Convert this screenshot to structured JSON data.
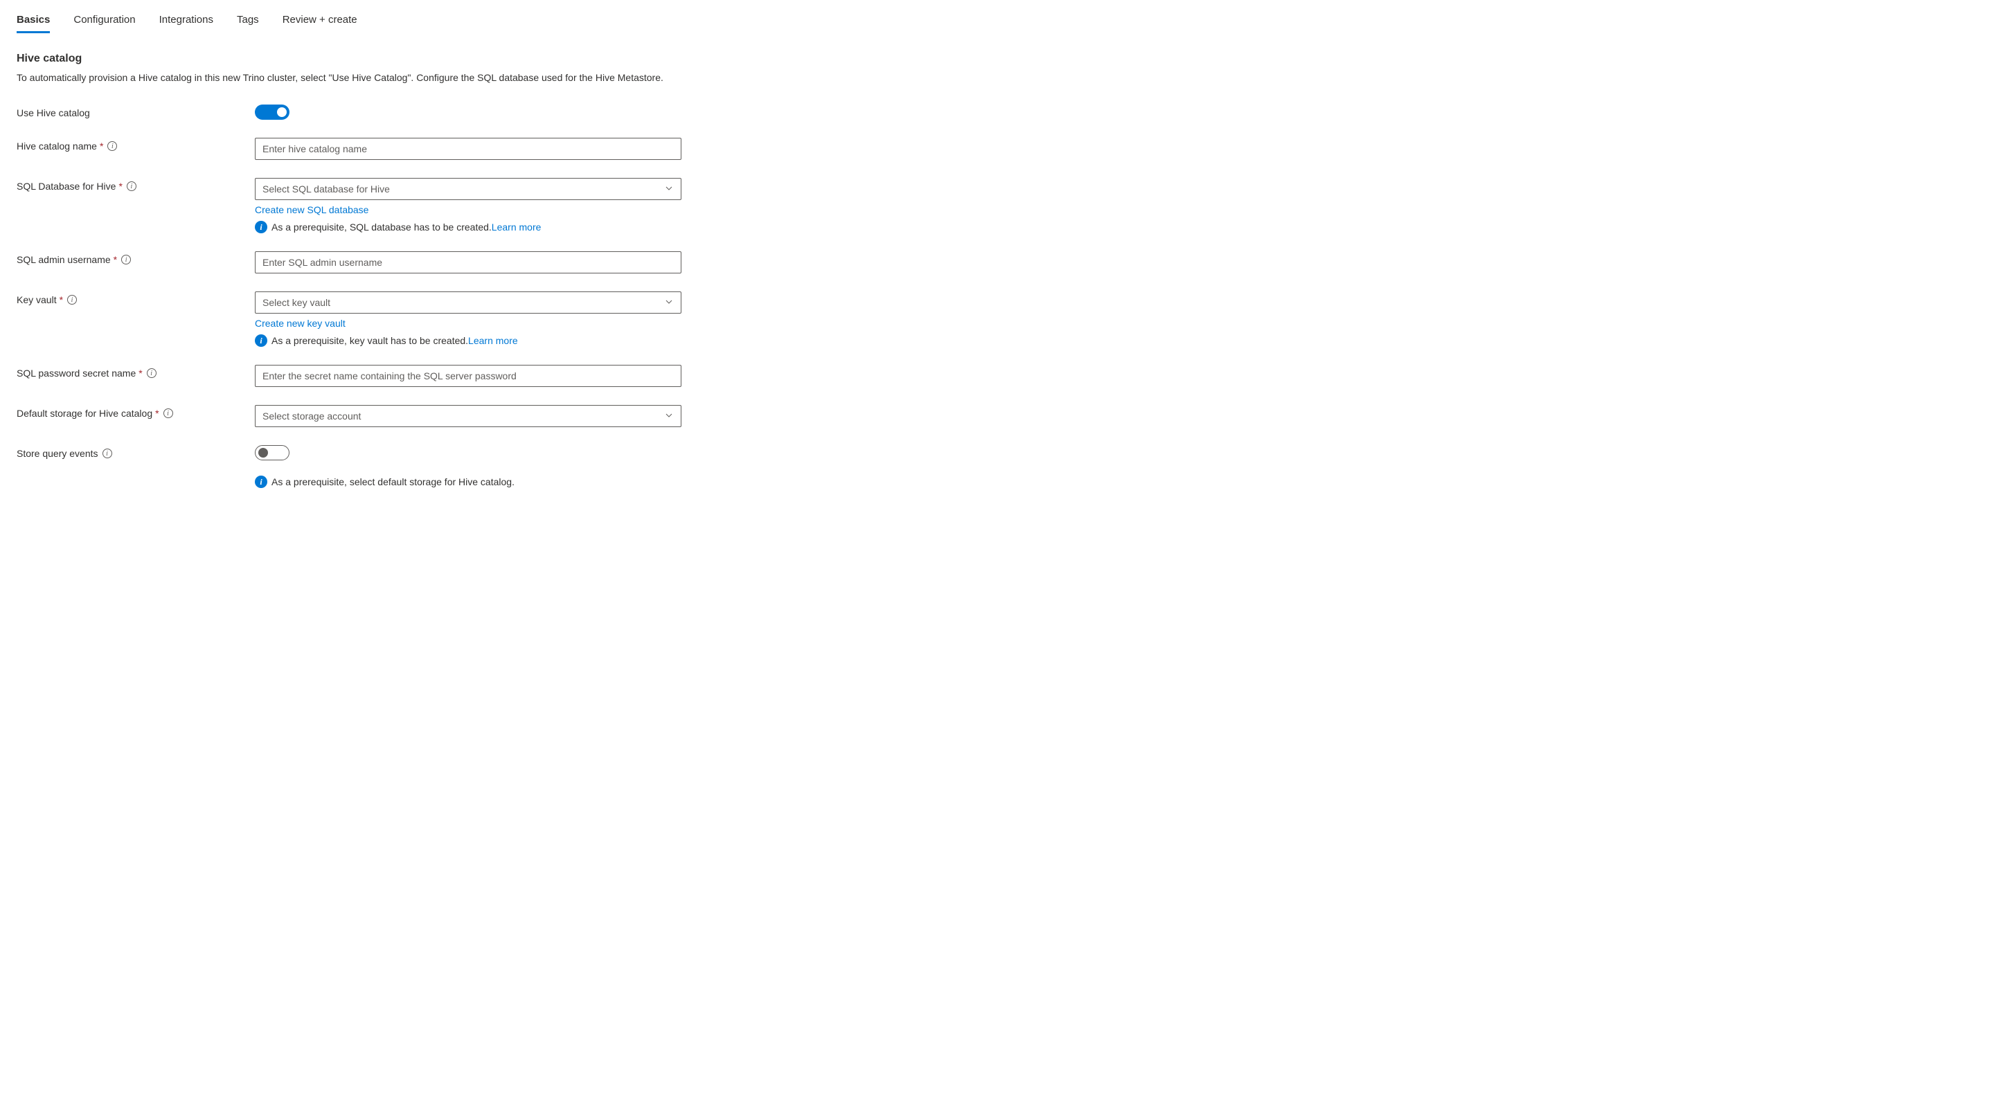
{
  "tabs": {
    "items": [
      {
        "label": "Basics",
        "active": true
      },
      {
        "label": "Configuration",
        "active": false
      },
      {
        "label": "Integrations",
        "active": false
      },
      {
        "label": "Tags",
        "active": false
      },
      {
        "label": "Review + create",
        "active": false
      }
    ]
  },
  "section": {
    "title": "Hive catalog",
    "description": "To automatically provision a Hive catalog in this new Trino cluster, select \"Use Hive Catalog\". Configure the SQL database used for the Hive Metastore."
  },
  "fields": {
    "useHiveCatalog": {
      "label": "Use Hive catalog",
      "value": true
    },
    "hiveCatalogName": {
      "label": "Hive catalog name",
      "placeholder": "Enter hive catalog name"
    },
    "sqlDatabase": {
      "label": "SQL Database for Hive",
      "placeholder": "Select SQL database for Hive",
      "createLink": "Create new SQL database",
      "prereq": "As a prerequisite, SQL database has to be created.",
      "learnMore": "Learn more"
    },
    "sqlAdminUsername": {
      "label": "SQL admin username",
      "placeholder": "Enter SQL admin username"
    },
    "keyVault": {
      "label": "Key vault",
      "placeholder": "Select key vault",
      "createLink": "Create new key vault",
      "prereq": "As a prerequisite, key vault has to be created.",
      "learnMore": "Learn more"
    },
    "sqlPasswordSecret": {
      "label": "SQL password secret name",
      "placeholder": "Enter the secret name containing the SQL server password"
    },
    "defaultStorage": {
      "label": "Default storage for Hive catalog",
      "placeholder": "Select storage account"
    },
    "storeQueryEvents": {
      "label": "Store query events",
      "value": false,
      "prereq": "As a prerequisite, select default storage for Hive catalog."
    }
  }
}
